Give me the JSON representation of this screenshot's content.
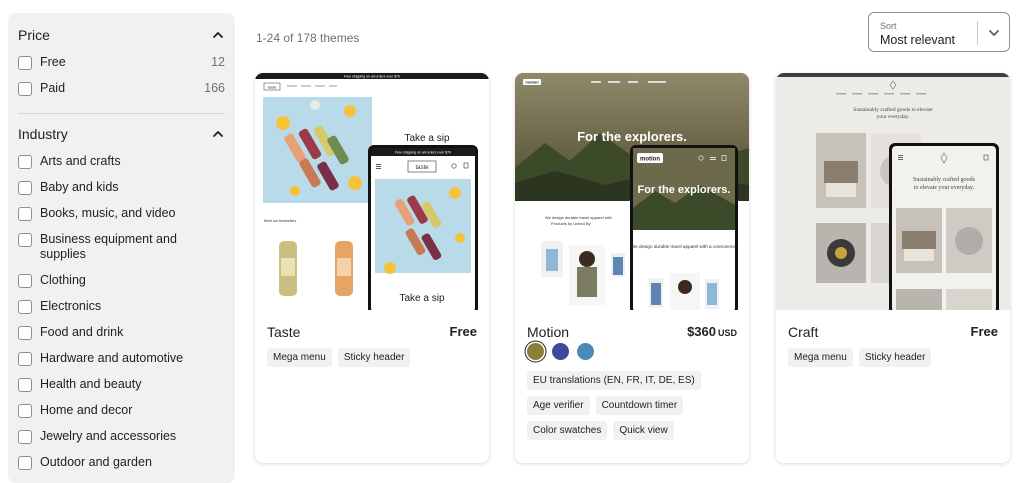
{
  "filters": {
    "price": {
      "title": "Price",
      "options": [
        {
          "label": "Free",
          "count": "12"
        },
        {
          "label": "Paid",
          "count": "166"
        }
      ]
    },
    "industry": {
      "title": "Industry",
      "options": [
        {
          "label": "Arts and crafts"
        },
        {
          "label": "Baby and kids"
        },
        {
          "label": "Books, music, and video"
        },
        {
          "label": "Business equipment and supplies"
        },
        {
          "label": "Clothing"
        },
        {
          "label": "Electronics"
        },
        {
          "label": "Food and drink"
        },
        {
          "label": "Hardware and automotive"
        },
        {
          "label": "Health and beauty"
        },
        {
          "label": "Home and decor"
        },
        {
          "label": "Jewelry and accessories"
        },
        {
          "label": "Outdoor and garden"
        }
      ]
    }
  },
  "results": {
    "text": "1-24 of 178 themes"
  },
  "sort": {
    "label": "Sort",
    "value": "Most relevant"
  },
  "themes": [
    {
      "name": "Taste",
      "price": "Free",
      "currency": "",
      "tags": [
        "Mega menu",
        "Sticky header"
      ],
      "preview": {
        "announcement": "Free shipping on all orders over $70",
        "logo": "taste",
        "headline": "Take a sip",
        "section": "Meet our bestsellers",
        "mobile_announcement": "Free shipping on all orders over $70",
        "mobile_logo": "taste",
        "mobile_headline": "Take a sip"
      }
    },
    {
      "name": "Motion",
      "price": "$360",
      "currency": "USD",
      "swatches": [
        "#8b7d3a",
        "#3b4a9c",
        "#4a8bb5"
      ],
      "tags": [
        "EU translations (EN, FR, IT, DE, ES)",
        "Age verifier",
        "Countdown timer",
        "Color swatches",
        "Quick view"
      ],
      "preview": {
        "logo": "motion",
        "headline": "For the explorers.",
        "body": "We design durable travel apparel with a conscience.",
        "body_partial": "We design durable travel apparel with",
        "body_partial2": "Products by United By",
        "mobile_logo": "motion",
        "mobile_headline": "For the explorers.",
        "mobile_body": "We design durable travel apparel with a conscience."
      }
    },
    {
      "name": "Craft",
      "price": "Free",
      "currency": "",
      "tags": [
        "Mega menu",
        "Sticky header"
      ],
      "preview": {
        "headline": "Sustainably crafted goods to elevate your everyday.",
        "mobile_headline": "Sustainably crafted goods to elevate your everyday."
      }
    }
  ]
}
